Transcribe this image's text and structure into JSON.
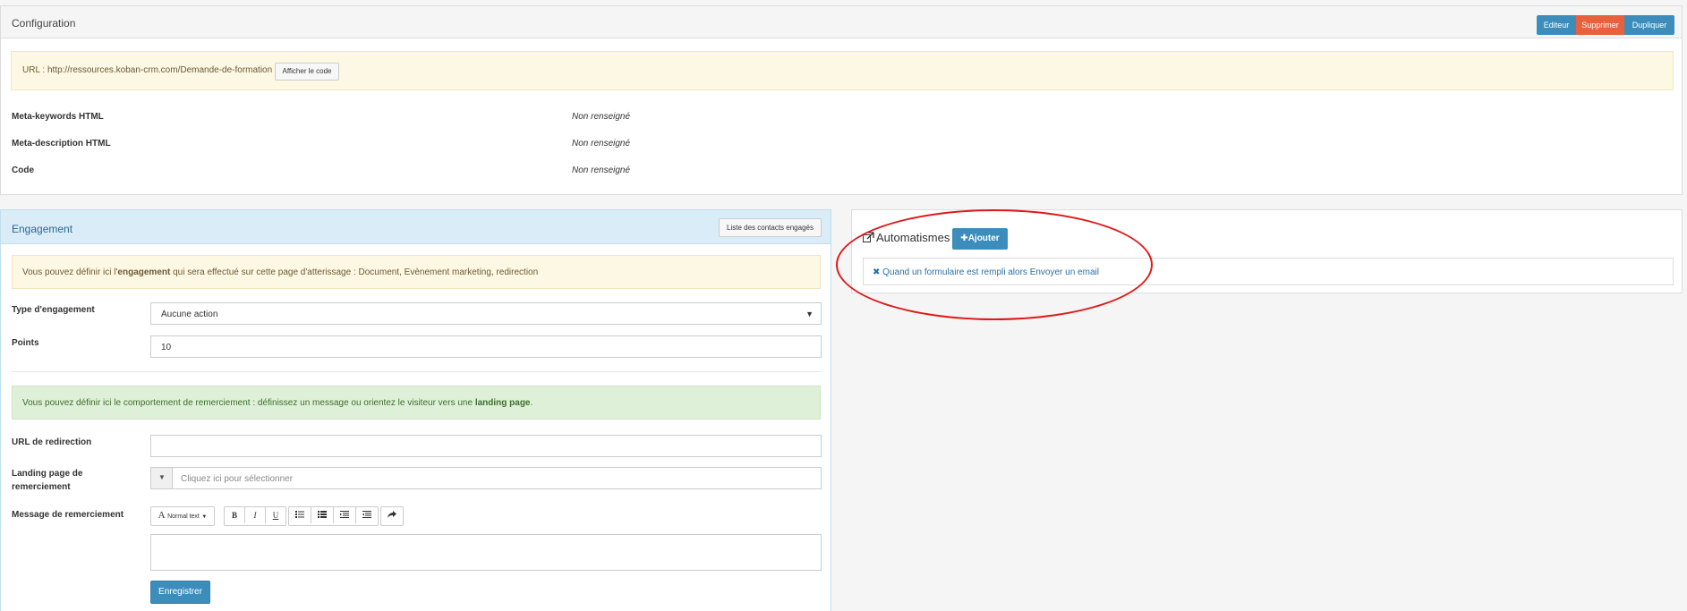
{
  "config": {
    "title": "Configuration",
    "buttons": {
      "edit": "Editeur",
      "delete": "Supprimer",
      "duplicate": "Dupliquer"
    },
    "url_text": "URL : http://ressources.koban-crm.com/Demande-de-formation",
    "show_code_button": "Afficher le code",
    "meta": [
      {
        "label": "Meta-keywords HTML",
        "value": "Non renseigné"
      },
      {
        "label": "Meta-description HTML",
        "value": "Non renseigné"
      },
      {
        "label": "Code",
        "value": "Non renseigné"
      }
    ]
  },
  "engagement": {
    "title": "Engagement",
    "list_button": "Liste des contacts engagés",
    "alert": {
      "before": "Vous pouvez définir ici l'",
      "bold": "engagement",
      "after": " qui sera effectué sur cette page d'atterissage : Document, Evènement marketing, redirection"
    },
    "type_label": "Type d'engagement",
    "type_value": "Aucune action",
    "points_label": "Points",
    "points_value": "10",
    "thanks_alert": {
      "before": "Vous pouvez définir ici le comportement de remerciement : définissez un message ou orientez le visiteur vers une ",
      "bold": "landing page",
      "after": "."
    },
    "redirect_label": "URL de redirection",
    "redirect_value": "",
    "landing_label_1": "Landing page de",
    "landing_label_2": "remerciement",
    "landing_placeholder": "Cliquez ici pour sélectionner",
    "message_label": "Message de remerciement",
    "toolbar": {
      "font_label": "Normal text",
      "bold": "B",
      "italic": "I",
      "underline": "U"
    },
    "save_button": "Enregistrer"
  },
  "automatismes": {
    "title": "Automatismes",
    "add_button": "Ajouter",
    "items": [
      {
        "text": "Quand un formulaire est rempli alors Envoyer un email"
      }
    ]
  },
  "colors": {
    "primary": "#3c8dbc",
    "danger": "#e8603c",
    "warning_bg": "#fcf8e3",
    "success_bg": "#dff0d8",
    "info_bg": "#d9ecf7",
    "annotation": "#e01818"
  }
}
